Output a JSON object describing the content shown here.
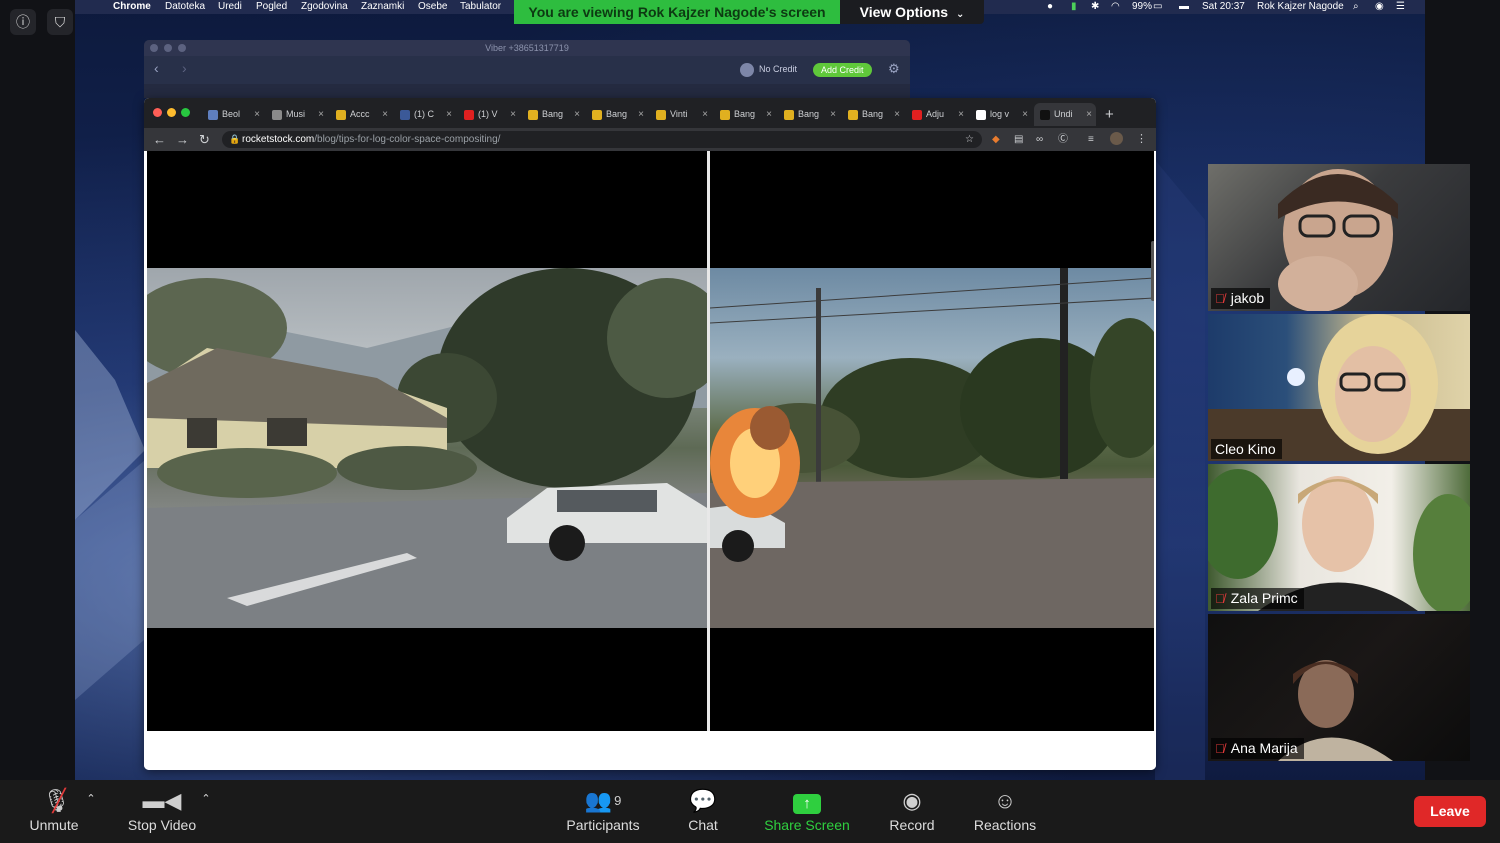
{
  "menubar": {
    "app_name": "Chrome",
    "items": [
      "Datoteka",
      "Uredi",
      "Pogled",
      "Zgodovina",
      "Zaznamki",
      "Osebe",
      "Tabulator"
    ],
    "battery": "99%",
    "clock": "Sat 20:37",
    "user": "Rok Kajzer Nagode"
  },
  "zoom_banner": {
    "viewing_text": "You are viewing Rok Kajzer Nagode's screen",
    "view_options_label": "View Options"
  },
  "viber": {
    "title": "Viber +38651317719",
    "no_credit": "No Credit",
    "add_credit": "Add Credit"
  },
  "browser": {
    "tabs": [
      {
        "label": "Beol",
        "color": "#5f7fbf"
      },
      {
        "label": "Musi",
        "color": "#8a8a8a"
      },
      {
        "label": "Accc",
        "color": "#e0b020"
      },
      {
        "label": "(1) C",
        "color": "#3b5998"
      },
      {
        "label": "(1) V",
        "color": "#e02020"
      },
      {
        "label": "Bang",
        "color": "#e0b020"
      },
      {
        "label": "Bang",
        "color": "#e0b020"
      },
      {
        "label": "Vinti",
        "color": "#e0b020"
      },
      {
        "label": "Bang",
        "color": "#e0b020"
      },
      {
        "label": "Bang",
        "color": "#e0b020"
      },
      {
        "label": "Bang",
        "color": "#e0b020"
      },
      {
        "label": "Adju",
        "color": "#e02020"
      },
      {
        "label": "log v",
        "color": "#ffffff"
      },
      {
        "label": "Undi",
        "color": "#111111",
        "active": true
      }
    ],
    "url_domain": "rocketstock.com",
    "url_path": "/blog/tips-for-log-color-space-compositing/"
  },
  "participants": [
    {
      "name": "jakob",
      "muted": true
    },
    {
      "name": "Cleo Kino",
      "muted": false
    },
    {
      "name": "Zala Primc",
      "muted": true
    },
    {
      "name": "Ana Marija",
      "muted": true
    }
  ],
  "toolbar": {
    "unmute": "Unmute",
    "stop_video": "Stop Video",
    "participants_label": "Participants",
    "participants_count": "9",
    "chat": "Chat",
    "share_screen": "Share Screen",
    "record": "Record",
    "reactions": "Reactions",
    "leave": "Leave"
  },
  "colors": {
    "banner_green": "#2ebd3f",
    "share_green": "#2fcf3f",
    "leave_red": "#e02828",
    "mute_red": "#e23a3a"
  }
}
